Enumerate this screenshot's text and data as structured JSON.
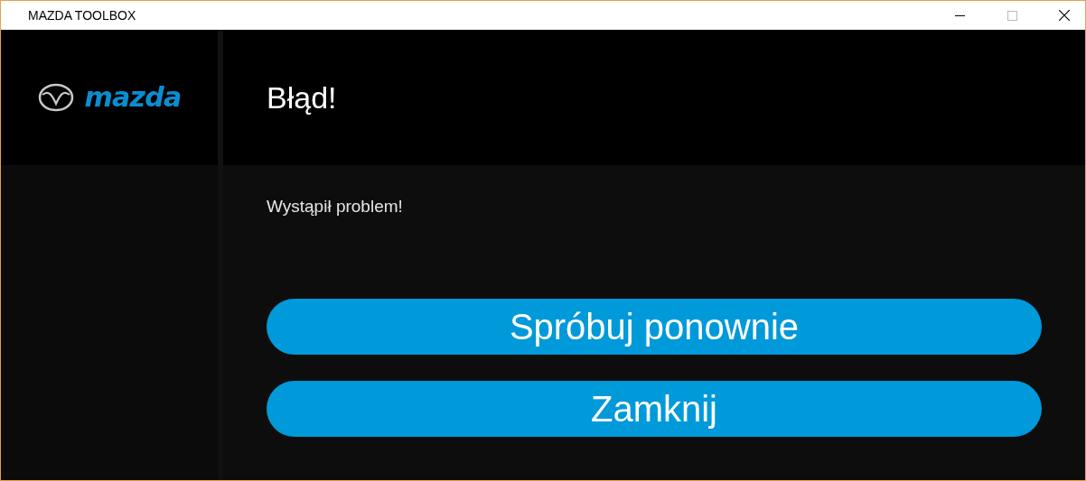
{
  "window": {
    "title": "MAZDA TOOLBOX"
  },
  "logo": {
    "wordmark": "mazda"
  },
  "header": {
    "title": "Błąd!"
  },
  "message": "Wystąpił problem!",
  "buttons": [
    "Spróbuj ponownie",
    "Zamknij"
  ]
}
